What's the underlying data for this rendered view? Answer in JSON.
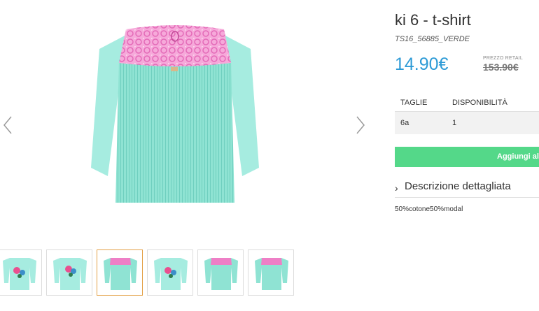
{
  "product": {
    "title": "ki 6 - t-shirt",
    "sku": "TS16_56885_VERDE",
    "price": "14.90€",
    "retail_label": "PREZZO RETAIL",
    "retail_price": "153.90€"
  },
  "sizes_table": {
    "headers": [
      "TAGLIE",
      "DISPONIBILITÀ"
    ],
    "rows": [
      {
        "size": "6a",
        "availability": "1"
      }
    ]
  },
  "add_to_cart": {
    "label": "Aggiungi al c"
  },
  "description": {
    "toggle_icon": "chevron-right-icon",
    "label": "Descrizione dettagliata",
    "text": "50%cotone50%modal"
  },
  "gallery": {
    "thumbnails": [
      "front-floral",
      "front-floral",
      "back-lace",
      "front-floral",
      "back-lace",
      "back-lace"
    ],
    "active_index": 2
  },
  "colors": {
    "accent": "#2c9ad6",
    "button": "#54d889",
    "garment": "#9ee8dc",
    "lace": "#ee7fc6",
    "active_border": "#e3a046"
  }
}
